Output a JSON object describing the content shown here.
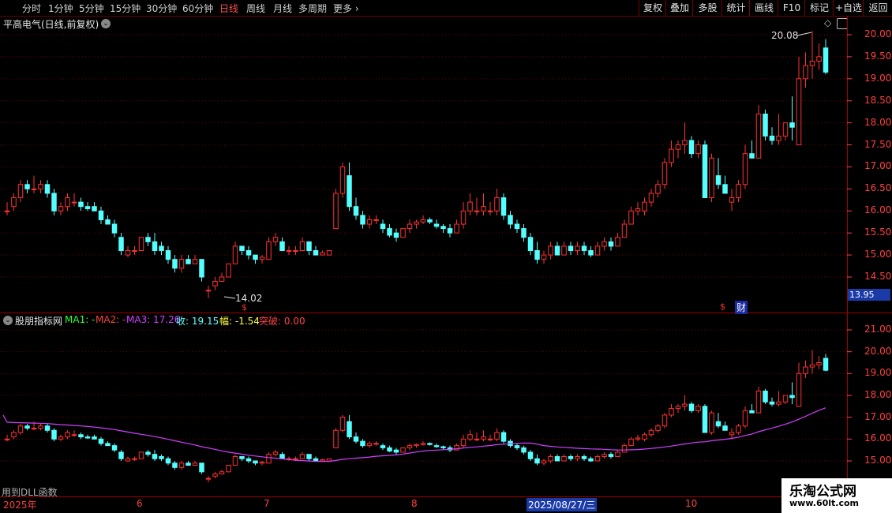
{
  "toolbar": {
    "periods": [
      "分时",
      "1分钟",
      "5分钟",
      "15分钟",
      "30分钟",
      "60分钟",
      "日线",
      "周线",
      "月线",
      "多周期",
      "更多"
    ],
    "active": "日线",
    "right_buttons": [
      "复权",
      "叠加",
      "多股",
      "统计",
      "画线",
      "F10",
      "标记",
      "+自选",
      "返回"
    ]
  },
  "main_panel": {
    "title": "平高电气(日线,前复权)",
    "price_axis": [
      "20.00",
      "19.50",
      "19.00",
      "18.50",
      "18.00",
      "17.50",
      "17.00",
      "16.50",
      "16.00",
      "15.50",
      "15.00",
      "14.50"
    ],
    "high_label": "20.08",
    "low_label": "14.02",
    "current_price_tag": "13.95",
    "markers": {
      "dollar": "$",
      "finance": "财"
    }
  },
  "indicator_panel": {
    "name": "股朋指标网",
    "ma1_label": "MA1: -",
    "ma2_label": "MA2: -",
    "ma3_label": "MA3: 17.26",
    "close_label": "收: 19.15",
    "change_label": "幅: -1.54",
    "break_label": "突破: 0.00",
    "axis": [
      "21.00",
      "20.00",
      "19.00",
      "18.00",
      "17.00",
      "16.00",
      "15.00"
    ],
    "footer_note": "用到DLL函数"
  },
  "time_axis": {
    "labels": [
      "2025年",
      "6",
      "7",
      "8",
      "10"
    ],
    "cursor_date": "2025/08/27/三"
  },
  "watermark": {
    "text": "乐淘公式网",
    "url": "www.60lt.com"
  },
  "colors": {
    "up": "#ff3232",
    "down": "#54ffff",
    "ma3": "#d040ff",
    "grid": "#6a0000",
    "axis_text": "#ff4040"
  },
  "chart_data": {
    "type": "candlestick",
    "ohlc_approx": [
      [
        16.0,
        16.2,
        15.9,
        16.0
      ],
      [
        16.1,
        16.4,
        16.0,
        16.3
      ],
      [
        16.3,
        16.7,
        16.2,
        16.6
      ],
      [
        16.6,
        16.7,
        16.4,
        16.5
      ],
      [
        16.5,
        16.8,
        16.4,
        16.5
      ],
      [
        16.5,
        16.7,
        16.4,
        16.6
      ],
      [
        16.6,
        16.7,
        16.3,
        16.4
      ],
      [
        16.4,
        16.5,
        15.9,
        16.0
      ],
      [
        16.0,
        16.2,
        15.9,
        16.1
      ],
      [
        16.1,
        16.4,
        16.0,
        16.3
      ],
      [
        16.2,
        16.4,
        16.1,
        16.2
      ],
      [
        16.2,
        16.3,
        16.0,
        16.1
      ],
      [
        16.1,
        16.2,
        16.0,
        16.05
      ],
      [
        16.1,
        16.2,
        16.0,
        16.0
      ],
      [
        16.0,
        16.1,
        15.7,
        15.8
      ],
      [
        15.8,
        15.9,
        15.7,
        15.7
      ],
      [
        15.7,
        15.8,
        15.4,
        15.5
      ],
      [
        15.4,
        15.5,
        15.0,
        15.1
      ],
      [
        15.0,
        15.2,
        14.95,
        15.1
      ],
      [
        15.1,
        15.2,
        15.0,
        15.1
      ],
      [
        15.1,
        15.4,
        15.1,
        15.4
      ],
      [
        15.4,
        15.5,
        15.2,
        15.3
      ],
      [
        15.3,
        15.5,
        15.0,
        15.1
      ],
      [
        15.2,
        15.3,
        15.0,
        15.1
      ],
      [
        15.1,
        15.2,
        14.8,
        14.9
      ],
      [
        14.9,
        15.0,
        14.6,
        14.7
      ],
      [
        14.7,
        15.0,
        14.6,
        14.9
      ],
      [
        14.9,
        15.0,
        14.8,
        14.8
      ],
      [
        14.8,
        15.0,
        14.8,
        14.9
      ],
      [
        14.9,
        14.9,
        14.4,
        14.5
      ],
      [
        14.2,
        14.3,
        14.02,
        14.2
      ],
      [
        14.3,
        14.5,
        14.2,
        14.4
      ],
      [
        14.4,
        14.6,
        14.4,
        14.5
      ],
      [
        14.5,
        14.8,
        14.5,
        14.8
      ],
      [
        14.8,
        15.3,
        14.8,
        15.2
      ],
      [
        15.2,
        15.2,
        15.0,
        15.1
      ],
      [
        15.1,
        15.2,
        14.9,
        15.0
      ],
      [
        15.0,
        15.0,
        14.8,
        14.9
      ],
      [
        14.9,
        15.0,
        14.8,
        14.95
      ],
      [
        14.9,
        15.4,
        14.9,
        15.3
      ],
      [
        15.3,
        15.5,
        15.2,
        15.4
      ],
      [
        15.3,
        15.4,
        15.1,
        15.1
      ],
      [
        15.1,
        15.2,
        15.0,
        15.1
      ],
      [
        15.1,
        15.2,
        15.0,
        15.1
      ],
      [
        15.1,
        15.4,
        15.1,
        15.3
      ],
      [
        15.3,
        15.3,
        15.0,
        15.1
      ],
      [
        15.1,
        15.2,
        15.0,
        15.0
      ],
      [
        15.0,
        15.1,
        15.0,
        15.05
      ],
      [
        15.0,
        15.1,
        15.0,
        15.1
      ],
      [
        15.6,
        16.5,
        15.6,
        16.4
      ],
      [
        16.4,
        17.1,
        16.3,
        17.0
      ],
      [
        16.8,
        17.1,
        16.0,
        16.1
      ],
      [
        16.1,
        16.3,
        15.8,
        15.9
      ],
      [
        15.9,
        16.0,
        15.6,
        15.7
      ],
      [
        15.7,
        15.9,
        15.6,
        15.8
      ],
      [
        15.8,
        15.9,
        15.7,
        15.8
      ],
      [
        15.7,
        15.8,
        15.5,
        15.6
      ],
      [
        15.6,
        15.7,
        15.4,
        15.45
      ],
      [
        15.5,
        15.6,
        15.3,
        15.4
      ],
      [
        15.4,
        15.6,
        15.4,
        15.6
      ],
      [
        15.6,
        15.8,
        15.5,
        15.7
      ],
      [
        15.7,
        15.8,
        15.6,
        15.75
      ],
      [
        15.75,
        15.9,
        15.7,
        15.8
      ],
      [
        15.8,
        15.85,
        15.7,
        15.75
      ],
      [
        15.7,
        15.8,
        15.6,
        15.65
      ],
      [
        15.65,
        15.7,
        15.5,
        15.6
      ],
      [
        15.6,
        15.7,
        15.4,
        15.5
      ],
      [
        15.5,
        15.8,
        15.5,
        15.7
      ],
      [
        15.7,
        16.2,
        15.6,
        16.0
      ],
      [
        16.0,
        16.4,
        15.9,
        16.2
      ],
      [
        16.0,
        16.3,
        15.9,
        16.0
      ],
      [
        16.0,
        16.4,
        15.9,
        16.1
      ],
      [
        16.0,
        16.2,
        15.9,
        16.0
      ],
      [
        16.0,
        16.5,
        15.9,
        16.3
      ],
      [
        16.3,
        16.4,
        15.8,
        15.9
      ],
      [
        15.9,
        16.0,
        15.6,
        15.7
      ],
      [
        15.7,
        15.8,
        15.5,
        15.6
      ],
      [
        15.6,
        15.7,
        15.3,
        15.4
      ],
      [
        15.4,
        15.5,
        15.0,
        15.1
      ],
      [
        15.1,
        15.3,
        14.8,
        14.9
      ],
      [
        14.9,
        15.1,
        14.8,
        15.0
      ],
      [
        15.0,
        15.3,
        14.9,
        15.2
      ],
      [
        15.2,
        15.3,
        15.0,
        15.0
      ],
      [
        15.0,
        15.3,
        15.0,
        15.2
      ],
      [
        15.2,
        15.3,
        15.0,
        15.1
      ],
      [
        15.1,
        15.3,
        15.0,
        15.2
      ],
      [
        15.2,
        15.3,
        15.0,
        15.1
      ],
      [
        15.1,
        15.2,
        14.95,
        15.0
      ],
      [
        15.0,
        15.3,
        15.0,
        15.2
      ],
      [
        15.2,
        15.4,
        15.1,
        15.3
      ],
      [
        15.3,
        15.4,
        15.1,
        15.2
      ],
      [
        15.2,
        15.5,
        15.2,
        15.4
      ],
      [
        15.4,
        15.8,
        15.4,
        15.7
      ],
      [
        15.7,
        16.1,
        15.7,
        16.0
      ],
      [
        16.0,
        16.2,
        15.9,
        16.05
      ],
      [
        16.0,
        16.3,
        15.9,
        16.2
      ],
      [
        16.2,
        16.5,
        16.1,
        16.4
      ],
      [
        16.4,
        16.7,
        16.3,
        16.6
      ],
      [
        16.6,
        17.2,
        16.5,
        17.1
      ],
      [
        17.1,
        17.6,
        17.0,
        17.4
      ],
      [
        17.4,
        17.6,
        17.2,
        17.5
      ],
      [
        17.5,
        18.0,
        17.3,
        17.6
      ],
      [
        17.6,
        17.7,
        17.2,
        17.3
      ],
      [
        17.3,
        17.6,
        17.2,
        17.5
      ],
      [
        17.5,
        17.6,
        16.4,
        16.3
      ],
      [
        16.3,
        17.3,
        16.2,
        17.2
      ],
      [
        16.8,
        17.2,
        16.5,
        16.6
      ],
      [
        16.6,
        16.8,
        16.4,
        16.4
      ],
      [
        16.2,
        16.5,
        16.0,
        16.3
      ],
      [
        16.3,
        16.7,
        16.2,
        16.6
      ],
      [
        16.6,
        17.5,
        16.5,
        17.3
      ],
      [
        17.3,
        17.6,
        17.2,
        17.2
      ],
      [
        17.2,
        18.4,
        17.2,
        18.2
      ],
      [
        18.2,
        18.3,
        17.6,
        17.7
      ],
      [
        17.7,
        17.9,
        17.5,
        17.6
      ],
      [
        17.6,
        18.2,
        17.5,
        17.7
      ],
      [
        17.7,
        18.0,
        17.6,
        18.0
      ],
      [
        18.0,
        18.6,
        17.6,
        17.9
      ],
      [
        17.5,
        19.5,
        17.5,
        19.0
      ],
      [
        19.0,
        19.6,
        18.8,
        19.3
      ],
      [
        19.3,
        20.08,
        19.0,
        19.4
      ],
      [
        19.4,
        19.8,
        19.2,
        19.5
      ],
      [
        19.7,
        19.9,
        19.1,
        19.15
      ]
    ]
  }
}
